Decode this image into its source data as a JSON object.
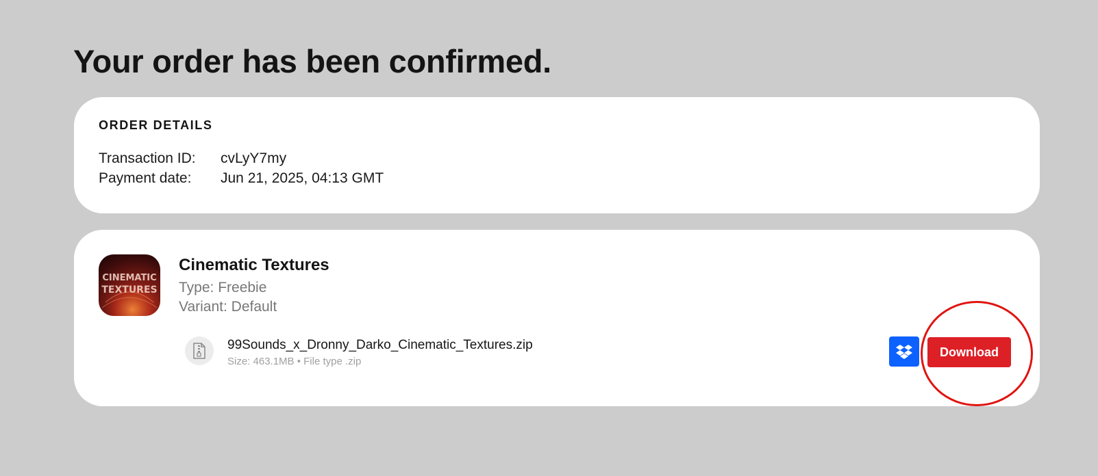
{
  "page": {
    "title": "Your order has been confirmed."
  },
  "order_details": {
    "heading": "ORDER DETAILS",
    "transaction_label": "Transaction ID:",
    "transaction_value": "cvLyY7my",
    "payment_label": "Payment date:",
    "payment_value": "Jun 21, 2025, 04:13 GMT"
  },
  "product": {
    "thumbnail_icon": "cinematic-textures-cover",
    "thumbnail_text_line1": "CINEMATIC",
    "thumbnail_text_line2": "TEXTURES",
    "name": "Cinematic Textures",
    "type": "Type: Freebie",
    "variant": "Variant: Default"
  },
  "file": {
    "icon": "zip-file-icon",
    "name": "99Sounds_x_Dronny_Darko_Cinematic_Textures.zip",
    "meta": "Size: 463.1MB • File type .zip"
  },
  "actions": {
    "dropbox_icon": "dropbox-icon",
    "download_label": "Download"
  },
  "colors": {
    "background": "#cccccc",
    "card": "#ffffff",
    "download_button": "#dd1f26",
    "dropbox_button": "#0d61ff",
    "highlight": "#e0130f"
  }
}
